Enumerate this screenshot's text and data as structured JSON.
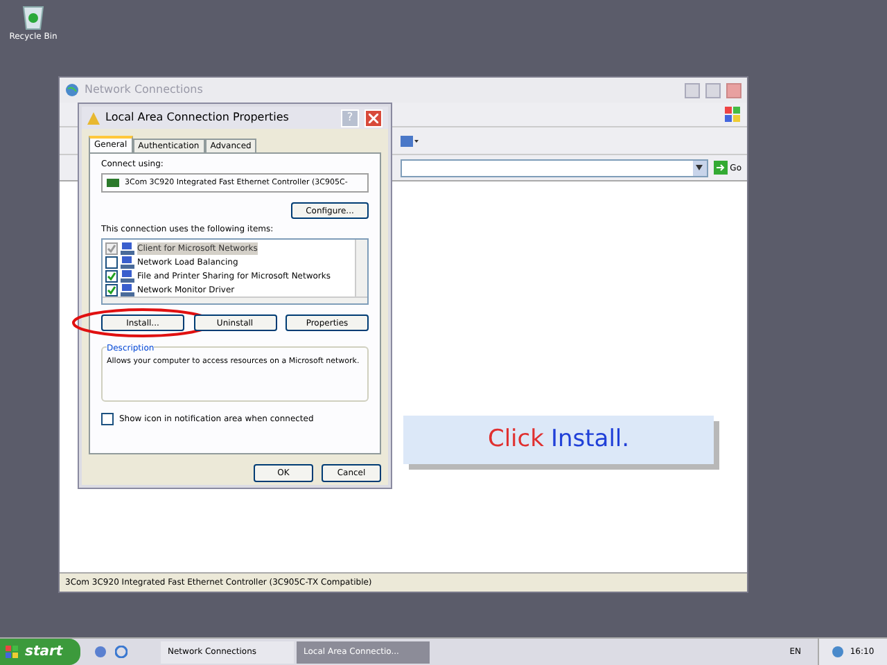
{
  "desktop_icons": [
    {
      "label": "Recycle Bin"
    }
  ],
  "background_window": {
    "title": "Network Connections",
    "go_label": "Go",
    "status_bar": "3Com 3C920 Integrated Fast Ethernet Controller (3C905C-TX Compatible)"
  },
  "dialog": {
    "title": "Local Area Connection Properties",
    "help": "?",
    "tabs": [
      {
        "label": "General",
        "selected": true
      },
      {
        "label": "Authentication",
        "selected": false
      },
      {
        "label": "Advanced",
        "selected": false
      }
    ],
    "connect_using_label": "Connect using:",
    "adapter": "3Com 3C920 Integrated Fast Ethernet Controller (3C905C-",
    "configure_button": "Configure...",
    "items_label": "This connection uses the following items:",
    "items": [
      {
        "label": "Client for Microsoft Networks",
        "checked": true,
        "disabled": true,
        "selected": true
      },
      {
        "label": "Network Load Balancing",
        "checked": false,
        "disabled": false,
        "selected": false
      },
      {
        "label": "File and Printer Sharing for Microsoft Networks",
        "checked": true,
        "disabled": false,
        "selected": false
      },
      {
        "label": "Network Monitor Driver",
        "checked": true,
        "disabled": false,
        "selected": false
      }
    ],
    "buttons": [
      {
        "label": "Install...",
        "highlighted": true
      },
      {
        "label": "Uninstall",
        "highlighted": false
      },
      {
        "label": "Properties",
        "highlighted": false
      }
    ],
    "description_label": "Description",
    "description": "Allows your computer to access resources on a Microsoft network.",
    "show_icon": {
      "label": "Show icon in notification area when connected",
      "checked": false
    },
    "footer_buttons": [
      "OK",
      "Cancel"
    ]
  },
  "callout": {
    "prefix": "Click",
    "action": "Install."
  },
  "taskbar": {
    "start": "start",
    "tasks": [
      {
        "label": "Network Connections",
        "selected": false
      },
      {
        "label": "Local Area Connectio...",
        "selected": true
      }
    ],
    "language": "EN",
    "clock": "16:10"
  }
}
